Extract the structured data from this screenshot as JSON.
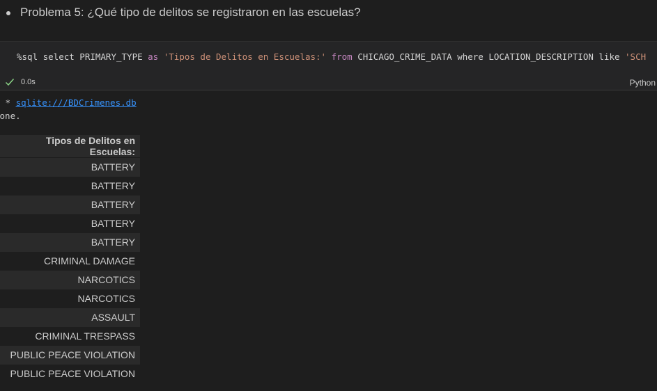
{
  "markdown": {
    "bullet_text": "Problema 5: ¿Qué tipo de delitos se registraron en las escuelas?"
  },
  "code_cell": {
    "tokens": {
      "t1": "%sql select PRIMARY_TYPE ",
      "t2": "as",
      "t3": " ",
      "t4": "'Tipos de Delitos en Escuelas:'",
      "t5": " ",
      "t6": "from",
      "t7": " CHICAGO_CRIME_DATA where LOCATION_DESCRIPTION like ",
      "t8": "'SCH"
    },
    "exec_time": "0.0s",
    "language": "Python",
    "status_icon": "check-icon",
    "status_color": "#89d185"
  },
  "output": {
    "prefix": " * ",
    "connection": "sqlite:///BDCrimenes.db",
    "done_text": "Done.",
    "table": {
      "header": "Tipos de Delitos en Escuelas:",
      "rows": [
        "BATTERY",
        "BATTERY",
        "BATTERY",
        "BATTERY",
        "BATTERY",
        "CRIMINAL DAMAGE",
        "NARCOTICS",
        "NARCOTICS",
        "ASSAULT",
        "CRIMINAL TRESPASS",
        "PUBLIC PEACE VIOLATION",
        "PUBLIC PEACE VIOLATION"
      ]
    }
  }
}
